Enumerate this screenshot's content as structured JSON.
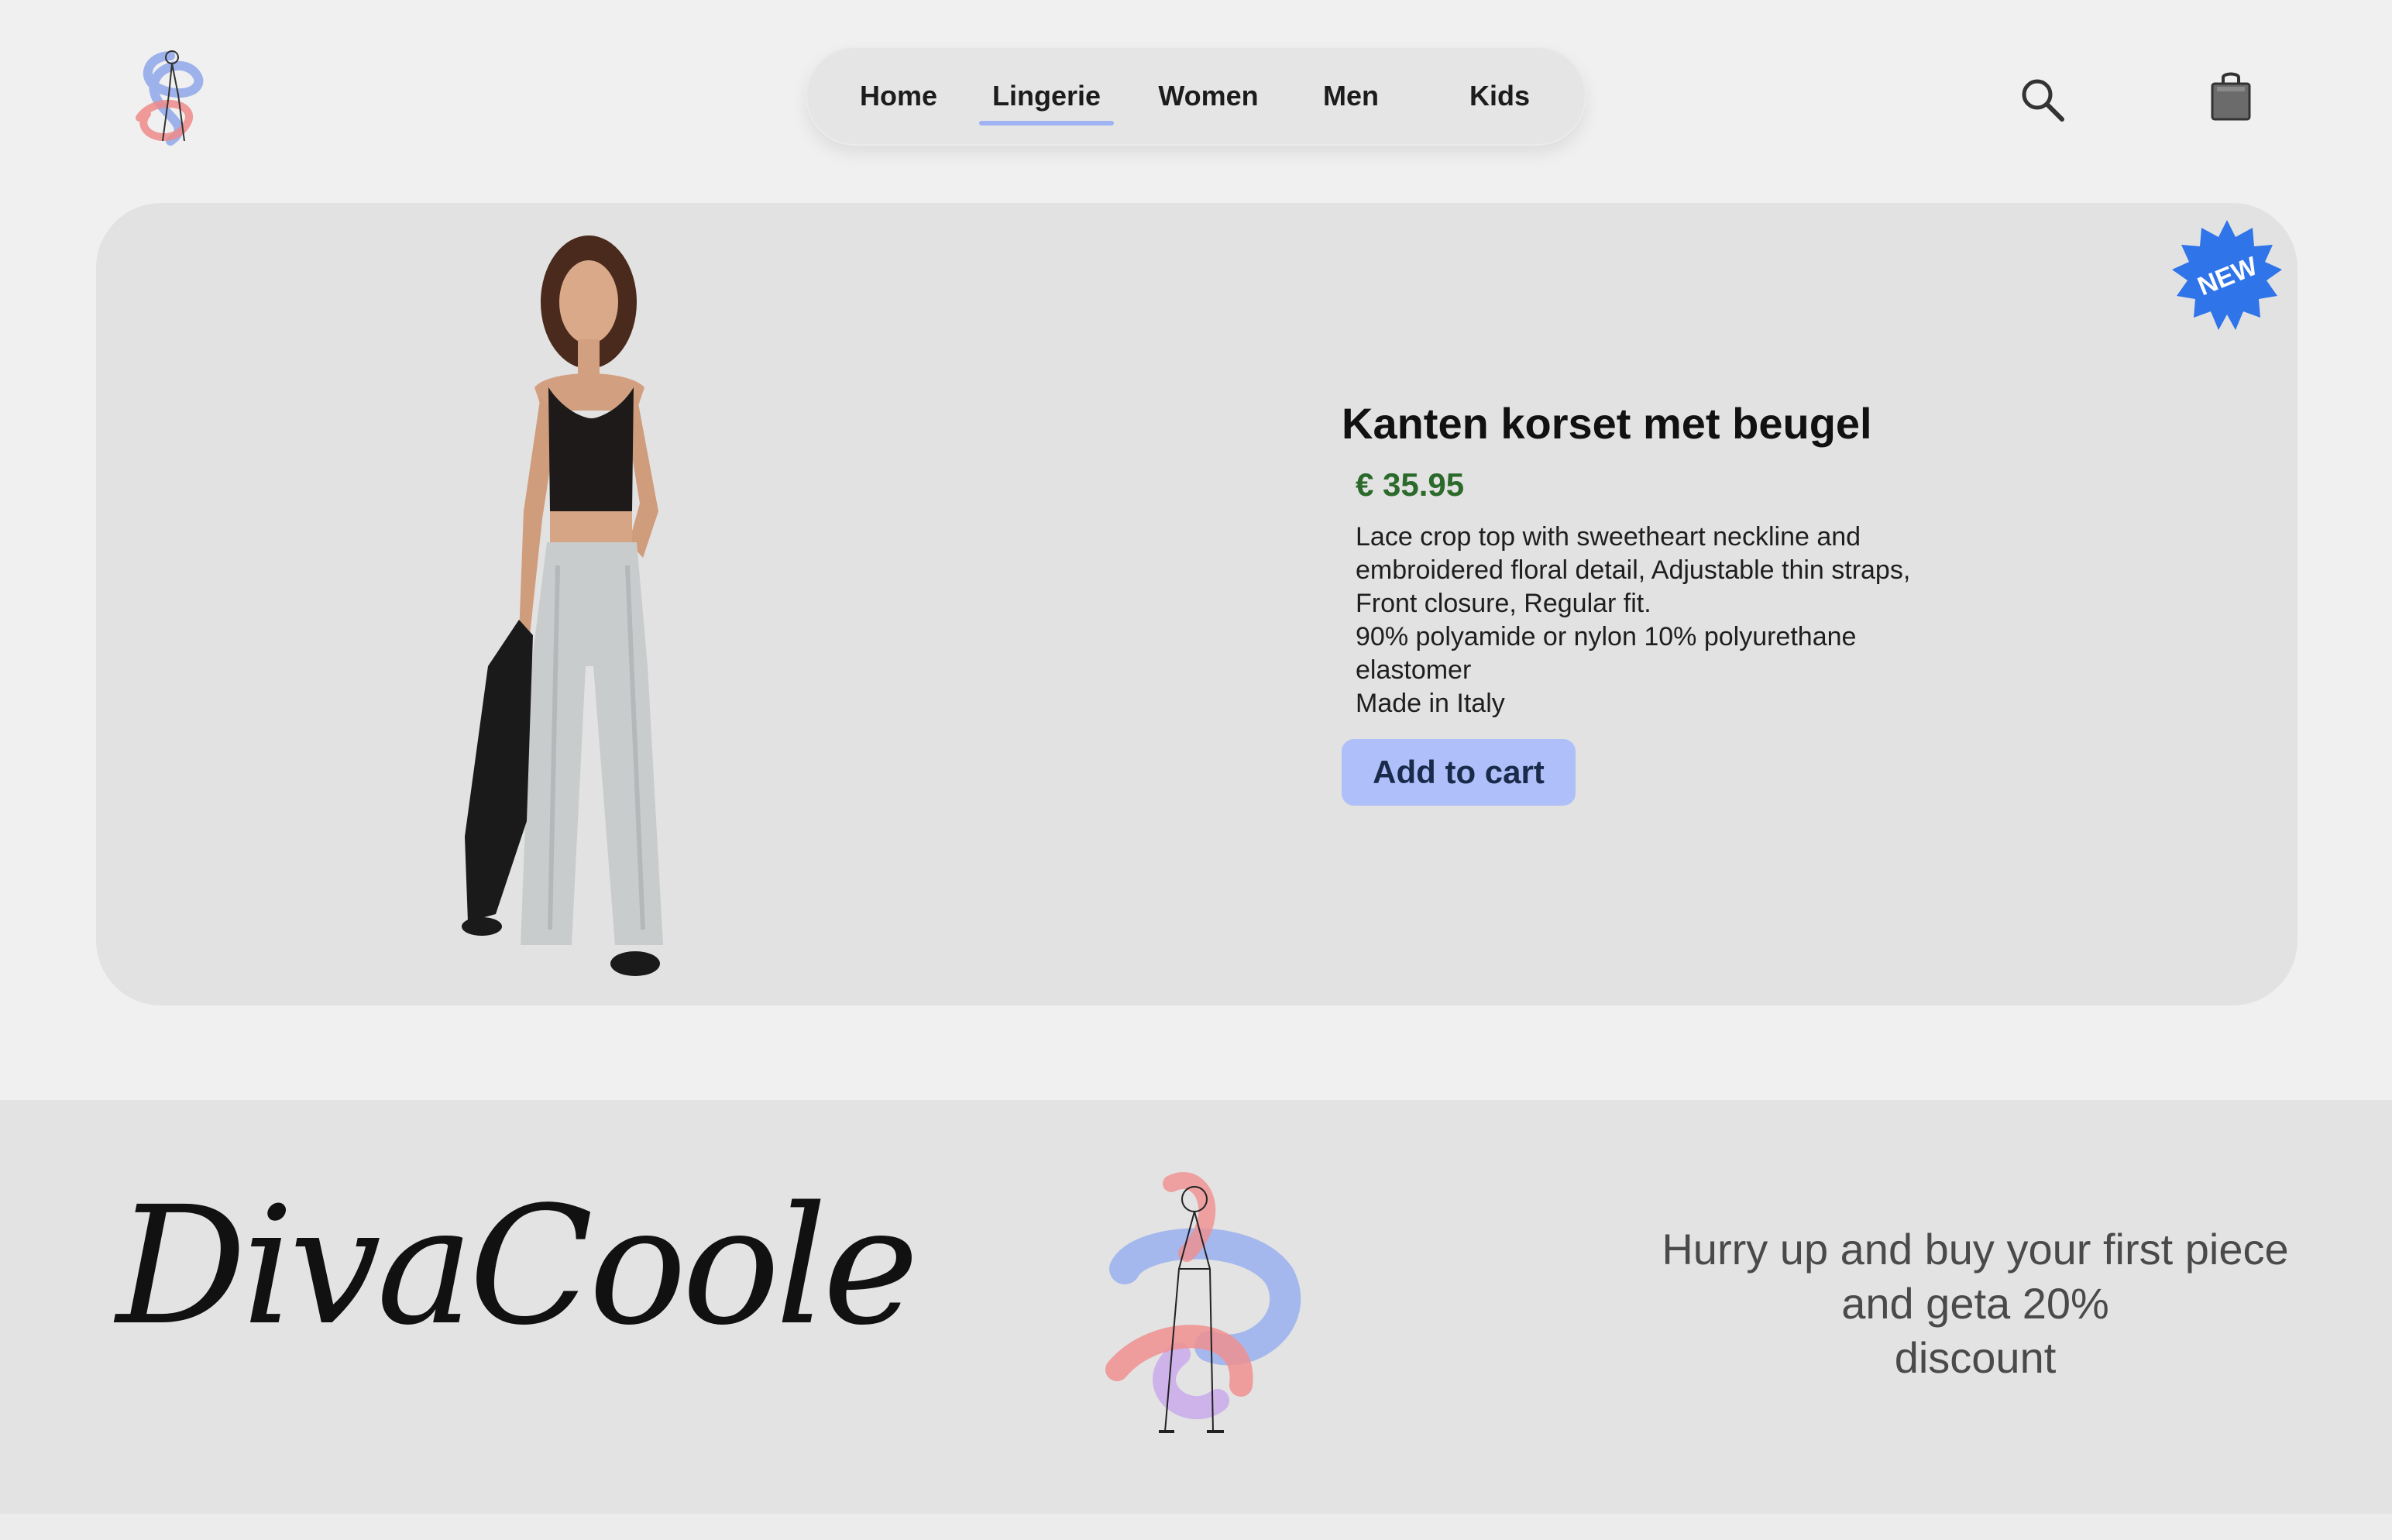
{
  "header": {
    "logo_icon": "divacoole-logo-icon",
    "nav": [
      "Home",
      "Lingerie",
      "Women",
      "Men",
      "Kids"
    ],
    "active_nav": "Lingerie",
    "search_icon": "search-icon",
    "cart_icon": "shopping-bag-icon"
  },
  "product": {
    "badge": "NEW",
    "title": "Kanten korset met beugel",
    "price": "€ 35.95",
    "description": [
      "Lace crop top with sweetheart neckline and",
      "embroidered floral detail, Adjustable thin straps,",
      "Front closure, Regular fit.",
      "90% polyamide or nylon 10% polyurethane",
      "elastomer",
      "Made in Italy"
    ],
    "add_to_cart": "Add to cart",
    "image_icon": "model-photo"
  },
  "footer": {
    "brand": "DivaCoole",
    "illustration_icon": "fashion-illustration-icon",
    "promo": [
      "Hurry up and buy your first piece",
      "and geta 20%",
      "discount"
    ]
  },
  "colors": {
    "background": "#f0f0f0",
    "card": "#e2e2e2",
    "accent": "#aebffa",
    "price": "#2c6a2c",
    "badge": "#2f74e8",
    "footer": "#e3e3e3"
  }
}
